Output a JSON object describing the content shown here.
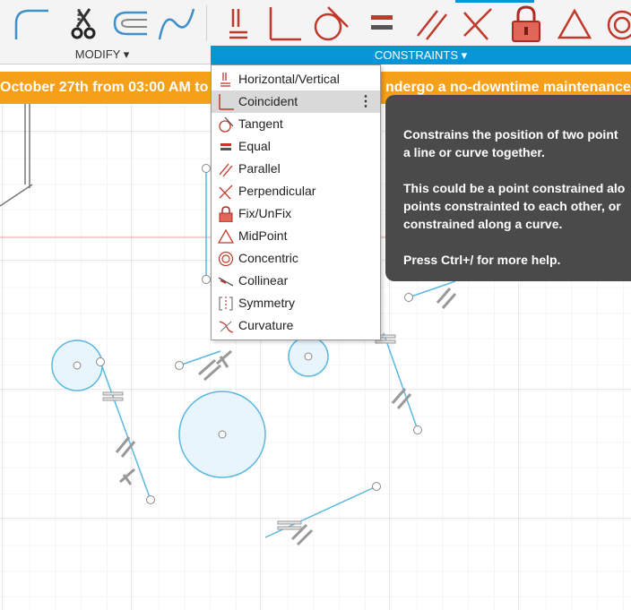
{
  "toolbar": {
    "modify_label": "MODIFY ▾",
    "constraints_label": "CONSTRAINTS ▾",
    "icons": [
      "fillet-icon",
      "trim-icon",
      "offset-icon",
      "spline-icon",
      "horizontal-vertical-icon",
      "coincident-icon",
      "tangent-icon",
      "equal-icon",
      "parallel-icon",
      "perpendicular-icon",
      "fix-unfix-icon",
      "midpoint-icon",
      "concentric-icon"
    ]
  },
  "banner": {
    "left_text": "October 27th from 03:00 AM to",
    "right_text": "ndergo a no-downtime maintenance."
  },
  "menu": {
    "items": [
      {
        "label": "Horizontal/Vertical",
        "icon": "horizontal-vertical-icon"
      },
      {
        "label": "Coincident",
        "icon": "coincident-icon"
      },
      {
        "label": "Tangent",
        "icon": "tangent-icon"
      },
      {
        "label": "Equal",
        "icon": "equal-icon"
      },
      {
        "label": "Parallel",
        "icon": "parallel-icon"
      },
      {
        "label": "Perpendicular",
        "icon": "perpendicular-icon"
      },
      {
        "label": "Fix/UnFix",
        "icon": "fix-unfix-icon"
      },
      {
        "label": "MidPoint",
        "icon": "midpoint-icon"
      },
      {
        "label": "Concentric",
        "icon": "concentric-icon"
      },
      {
        "label": "Collinear",
        "icon": "collinear-icon"
      },
      {
        "label": "Symmetry",
        "icon": "symmetry-icon"
      },
      {
        "label": "Curvature",
        "icon": "curvature-icon"
      }
    ],
    "highlighted": "Coincident",
    "more_glyph": "⋮"
  },
  "tooltip": {
    "line1": "Constrains the position of two point",
    "line2": "a line or curve together.",
    "line3": "This could be a point constrained alo",
    "line4": "points constrainted to each other, or",
    "line5": "constrained along a curve.",
    "line6": "Press Ctrl+/ for more help."
  },
  "colors": {
    "accent_blue": "#0696d7",
    "banner_orange": "#f6a01a",
    "constraint_red": "#c0392b",
    "sketch_blue": "#5bb8e0",
    "tooltip_bg": "#4a4a4a"
  }
}
